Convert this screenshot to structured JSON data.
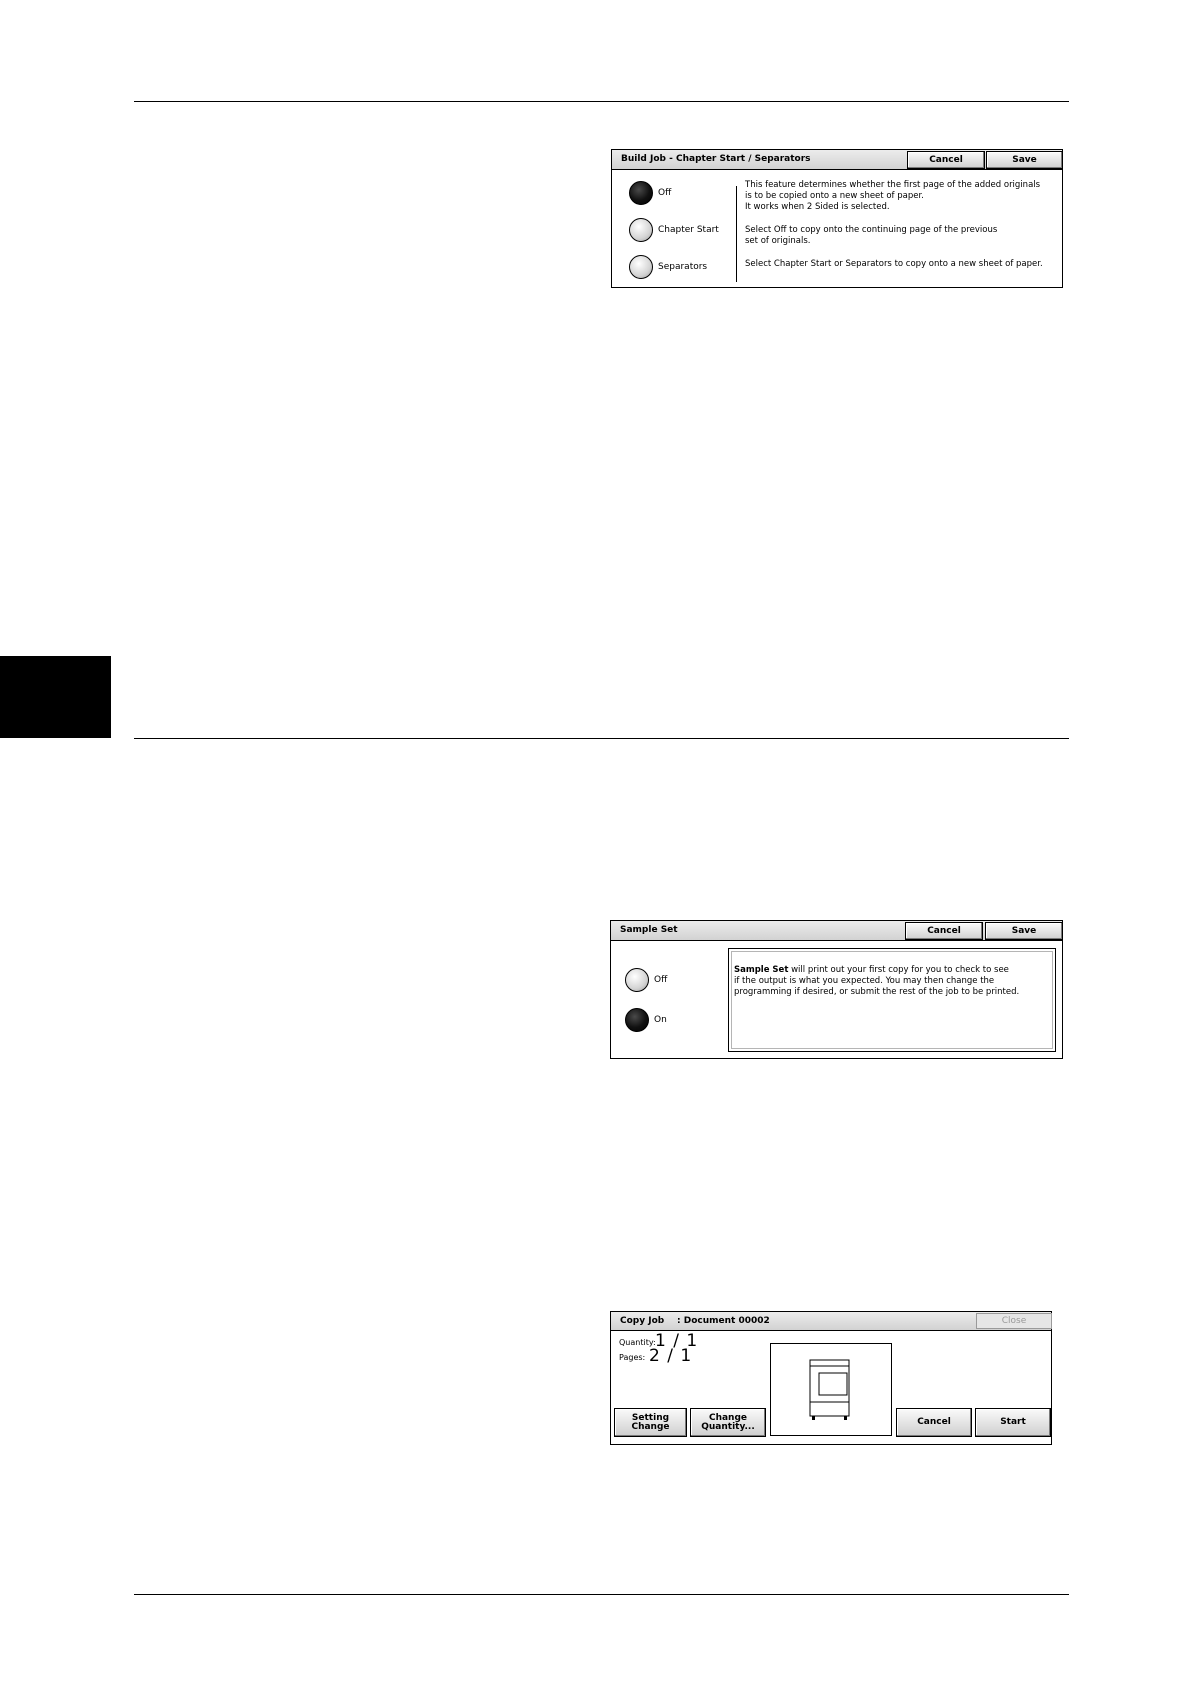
{
  "build_job_panel": {
    "title": "Build Job - Chapter Start / Separators",
    "cancel_label": "Cancel",
    "save_label": "Save",
    "options": [
      {
        "label": "Off",
        "selected": true
      },
      {
        "label": "Chapter Start",
        "selected": false
      },
      {
        "label": "Separators",
        "selected": false
      }
    ],
    "description": [
      "This feature determines whether the first page of the added originals",
      "is to be copied onto a new sheet of paper.",
      "It works when 2 Sided is selected.",
      "Select Off to copy onto the continuing page of the previous",
      "set of originals.",
      "Select Chapter Start or Separators to copy onto a new sheet of paper."
    ]
  },
  "sample_set_panel": {
    "title": "Sample Set",
    "cancel_label": "Cancel",
    "save_label": "Save",
    "options": [
      {
        "label": "Off",
        "selected": false
      },
      {
        "label": "On",
        "selected": true
      }
    ],
    "description_bold": "Sample Set",
    "description_line1": " will print out your first copy for you to check to see",
    "description_line2": "if the output is what you expected.  You may then change the",
    "description_line3": "programming if desired, or submit the rest of the job to be printed."
  },
  "copy_job_panel": {
    "title": "Copy Job",
    "document": ": Document 00002",
    "close_label": "Close",
    "quantity_label": "Quantity:",
    "quantity_value": "1 / 1",
    "pages_label": "Pages:",
    "pages_value": "2 / 1",
    "setting_change_line1": "Setting",
    "setting_change_line2": "Change",
    "change_quantity_line1": "Change",
    "change_quantity_line2": "Quantity...",
    "cancel_label": "Cancel",
    "start_label": "Start",
    "preview_icon": "copier-machine-icon"
  },
  "colors": {
    "chapter_tab": "#000000",
    "title_bar": "#d9d9d9"
  }
}
